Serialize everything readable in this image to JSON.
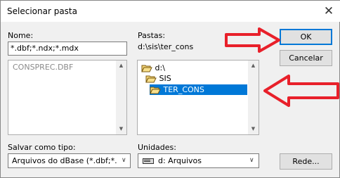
{
  "dialog": {
    "title": "Selecionar pasta",
    "close_glyph": "✕"
  },
  "filename": {
    "label": "Nome:",
    "value": "*.dbf;*.ndx;*.mdx",
    "files": [
      "CONSPREC.DBF"
    ]
  },
  "folders": {
    "label": "Pastas:",
    "current_path": "d:\\sis\\ter_cons",
    "tree": [
      {
        "name": "d:\\",
        "level": 0,
        "selected": false,
        "icon": "open-folder-icon"
      },
      {
        "name": "SIS",
        "level": 1,
        "selected": false,
        "icon": "open-folder-icon"
      },
      {
        "name": "TER_CONS",
        "level": 2,
        "selected": true,
        "icon": "open-folder-icon"
      }
    ]
  },
  "filetype": {
    "label": "Salvar como tipo:",
    "value": "Arquivos do dBase (*.dbf;*.ndx;*.mdx)"
  },
  "drives": {
    "label": "Unidades:",
    "value": "d: Arquivos",
    "icon": "drive-icon"
  },
  "buttons": {
    "ok": "OK",
    "cancel": "Cancelar",
    "network": "Rede..."
  },
  "annotations": {
    "arrow_color": "#e8202a"
  }
}
